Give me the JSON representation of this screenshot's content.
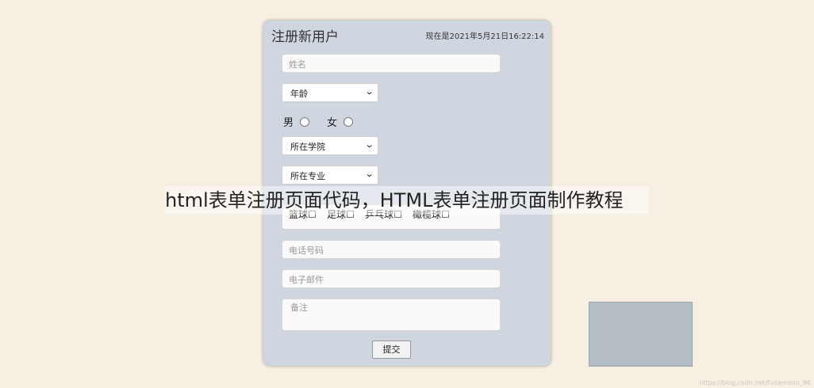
{
  "form": {
    "title": "注册新用户",
    "now_text": "现在是2021年5月21日16:22:14",
    "name_placeholder": "姓名",
    "age_select": "年龄",
    "gender": {
      "male": "男",
      "female": "女"
    },
    "college_select": "所在学院",
    "major_select": "所在专业",
    "hobbies": [
      "篮球",
      "足球",
      "乒乓球",
      "橄榄球"
    ],
    "phone_placeholder": "电话号码",
    "email_placeholder": "电子邮件",
    "remark_placeholder": "备注",
    "submit_label": "提交"
  },
  "overlay_caption": "html表单注册页面代码，HTML表单注册页面制作教程",
  "watermark": "https://blog.csdn.net/Fusamoon_96",
  "colors": {
    "page_bg": "#f6efe2",
    "card_bg": "#cfd6e0",
    "thumb_bg": "#b3bdc3"
  }
}
